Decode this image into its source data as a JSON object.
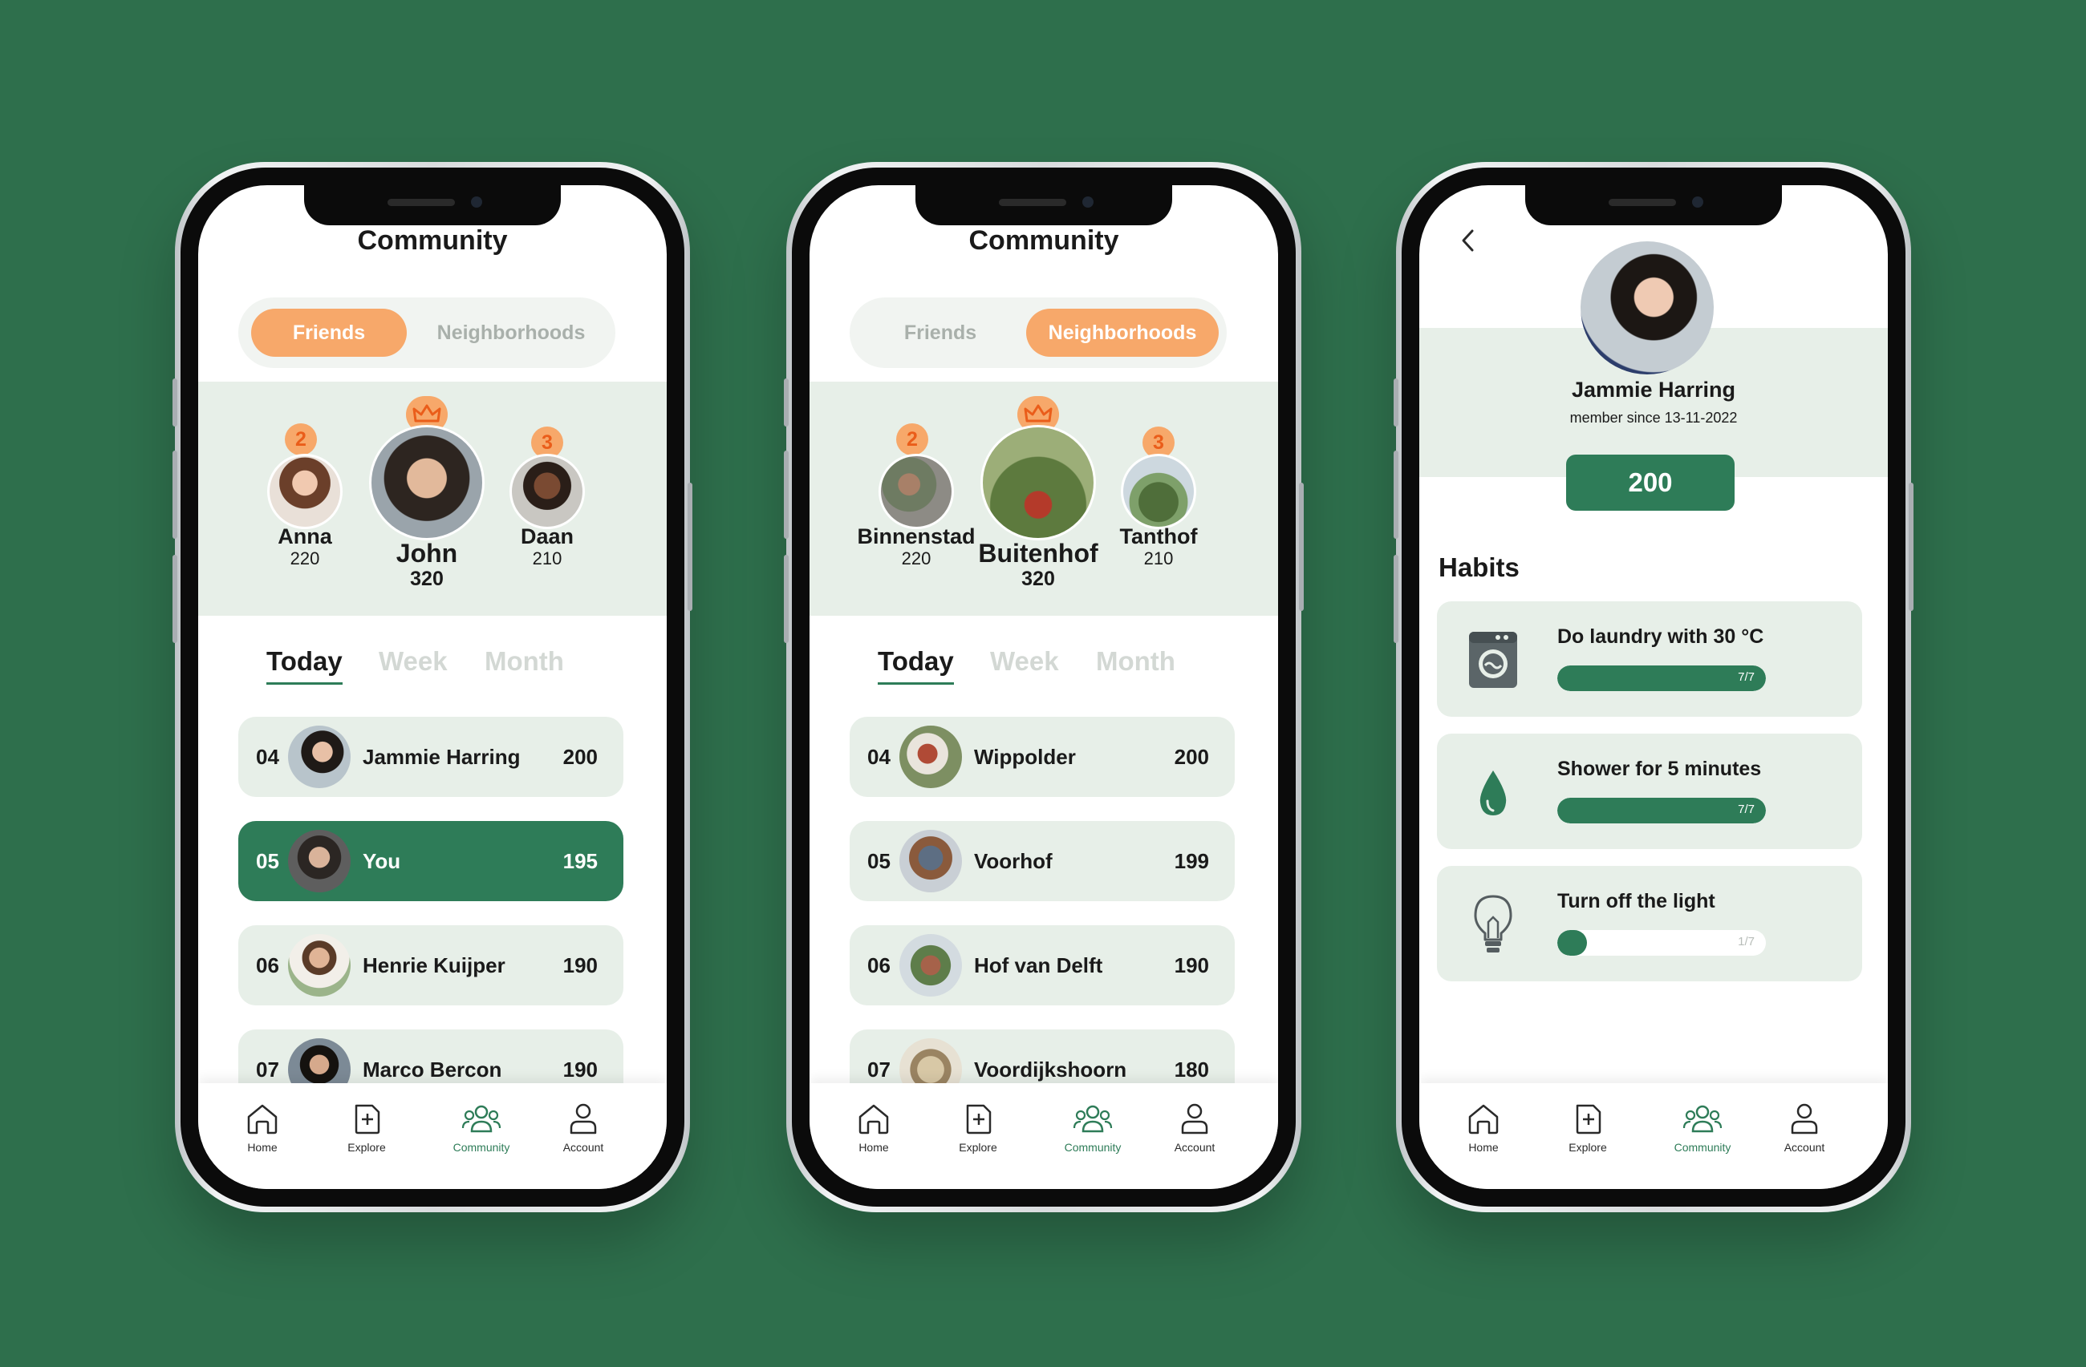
{
  "colors": {
    "background": "#2e6f4c",
    "accent_green": "#2e7c58",
    "accent_orange": "#f7a86a",
    "panel": "#e7efe8"
  },
  "nav": [
    {
      "label": "Home",
      "icon": "home-icon"
    },
    {
      "label": "Explore",
      "icon": "explore-icon"
    },
    {
      "label": "Community",
      "icon": "community-icon",
      "active": true
    },
    {
      "label": "Account",
      "icon": "account-icon"
    }
  ],
  "screen1": {
    "title": "Community",
    "tabs": [
      "Friends",
      "Neighborhoods"
    ],
    "active_tab": "Friends",
    "podium": [
      {
        "rank": "2",
        "name": "Anna",
        "score": "220"
      },
      {
        "rank": "1",
        "name": "John",
        "score": "320",
        "icon": "crown-icon"
      },
      {
        "rank": "3",
        "name": "Daan",
        "score": "210"
      }
    ],
    "periods": [
      "Today",
      "Week",
      "Month"
    ],
    "active_period": "Today",
    "rows": [
      {
        "rank": "04",
        "name": "Jammie Harring",
        "points": "200"
      },
      {
        "rank": "05",
        "name": "You",
        "points": "195",
        "highlighted": true
      },
      {
        "rank": "06",
        "name": "Henrie Kuijper",
        "points": "190"
      },
      {
        "rank": "07",
        "name": "Marco Bercon",
        "points": "190"
      }
    ]
  },
  "screen2": {
    "title": "Community",
    "tabs": [
      "Friends",
      "Neighborhoods"
    ],
    "active_tab": "Neighborhoods",
    "podium": [
      {
        "rank": "2",
        "name": "Binnenstad",
        "score": "220"
      },
      {
        "rank": "1",
        "name": "Buitenhof",
        "score": "320",
        "icon": "crown-icon"
      },
      {
        "rank": "3",
        "name": "Tanthof",
        "score": "210"
      }
    ],
    "periods": [
      "Today",
      "Week",
      "Month"
    ],
    "active_period": "Today",
    "rows": [
      {
        "rank": "04",
        "name": "Wippolder",
        "points": "200"
      },
      {
        "rank": "05",
        "name": "Voorhof",
        "points": "199"
      },
      {
        "rank": "06",
        "name": "Hof van Delft",
        "points": "190"
      },
      {
        "rank": "07",
        "name": "Voordijkshoorn",
        "points": "180"
      }
    ]
  },
  "screen3": {
    "back_icon": "chevron-left-icon",
    "name": "Jammie Harring",
    "member_since": "member since 13-11-2022",
    "score": "200",
    "habits_title": "Habits",
    "habits": [
      {
        "title": "Do laundry with 30 °C",
        "progress": "7/7",
        "fraction": 1.0,
        "icon": "washing-machine-icon"
      },
      {
        "title": "Shower for 5 minutes",
        "progress": "7/7",
        "fraction": 1.0,
        "icon": "water-drop-icon"
      },
      {
        "title": "Turn off the light",
        "progress": "1/7",
        "fraction": 0.143,
        "icon": "light-bulb-icon"
      }
    ]
  }
}
